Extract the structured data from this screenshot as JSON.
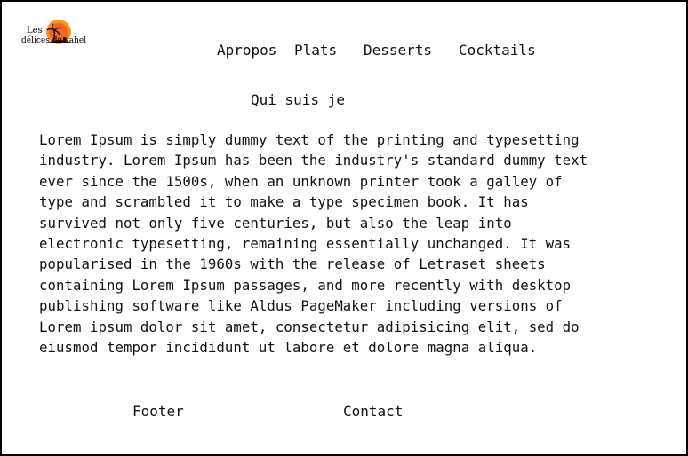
{
  "logo": {
    "line1": "Les",
    "line2": "délices du sahel",
    "icon": "sunset-palm-logo-icon",
    "colors": {
      "sun": "#f26522",
      "sun_glow": "#f7941d",
      "silhouette": "#1a1a1a"
    }
  },
  "nav": {
    "items": [
      {
        "label": "Apropos"
      },
      {
        "label": "Plats"
      },
      {
        "label": "Desserts"
      },
      {
        "label": "Cocktails"
      }
    ]
  },
  "main": {
    "heading": "Qui suis je",
    "lines": [
      "Lorem Ipsum is simply dummy text of the printing and typesetting",
      "industry. Lorem Ipsum has been the industry's standard dummy text",
      "ever since the 1500s, when an unknown printer took a galley of",
      "type and scrambled it to make a type specimen book. It has",
      "survived not only five centuries, but also the leap into",
      "electronic typesetting, remaining essentially unchanged. It was",
      "popularised in the 1960s with the release of Letraset sheets",
      "containing Lorem Ipsum passages, and more recently with desktop",
      "publishing software like Aldus PageMaker including versions of",
      "Lorem ipsum dolor sit amet, consectetur adipisicing elit, sed do",
      "eiusmod tempor incididunt ut labore et dolore magna aliqua."
    ]
  },
  "footer": {
    "label": "Footer",
    "contact": "Contact"
  }
}
